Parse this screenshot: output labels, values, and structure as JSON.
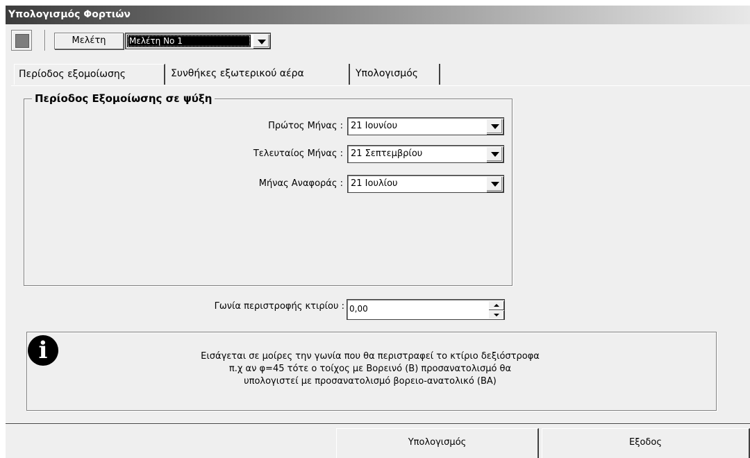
{
  "window": {
    "title": "Υπολογισμός Φορτιών"
  },
  "toolbar": {
    "study_label": "Μελέτη",
    "study_selected": "Μελέτη Νο 1"
  },
  "tabs": [
    {
      "label": "Περίοδος εξομοίωσης",
      "active": true
    },
    {
      "label": "Συνθήκες εξωτερικού αέρα",
      "active": false
    },
    {
      "label": "Υπολογισμός",
      "active": false
    }
  ],
  "simulation": {
    "group_title": "Περίοδος Εξομοίωσης σε ψύξη",
    "first_month_label": "Πρώτος Μήνας :",
    "first_month_value": "21 Ιουνίου",
    "last_month_label": "Τελευταίος Μήνας :",
    "last_month_value": "21 Σεπτεμβρίου",
    "reference_month_label": "Μήνας Αναφοράς :",
    "reference_month_value": "21 Ιουλίου"
  },
  "rotation": {
    "label": "Γωνία περιστροφής κτιρίου :",
    "value": "0,00"
  },
  "info": {
    "icon": "info-icon",
    "lines": [
      "Εισάγεται σε μοίρες την γωνία που θα περιστραφεί το κτίριο δεξιόστροφα",
      "π.χ αν φ=45 τότε ο τοίχος με Βορεινό (Β) προσανατολισμό θα",
      "υπολογιστεί με προσανατολισμό βορειο-ανατολικό (ΒΑ)"
    ]
  },
  "buttons": {
    "calculate": "Υπολογισμός",
    "exit": "Εξοδος"
  },
  "colors": {
    "window_bg": "#efefef",
    "selection_bg": "#000000"
  }
}
